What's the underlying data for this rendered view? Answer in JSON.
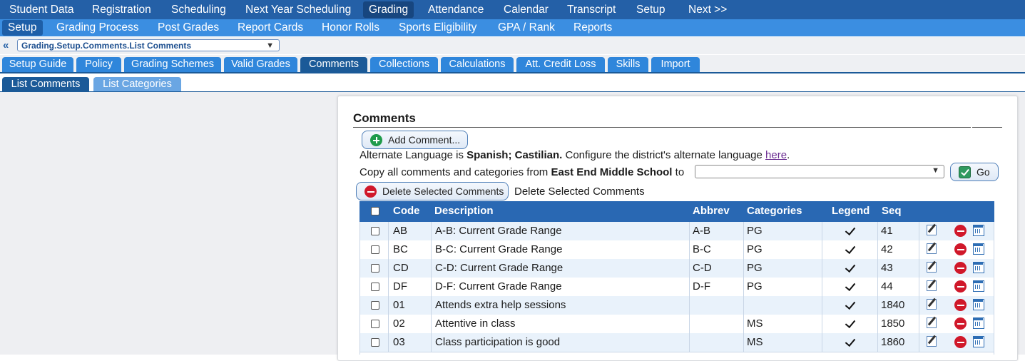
{
  "nav_primary": [
    "Student Data",
    "Registration",
    "Scheduling",
    "Next Year Scheduling",
    "Grading",
    "Attendance",
    "Calendar",
    "Transcript",
    "Setup",
    "Next >>"
  ],
  "nav_secondary": [
    "Setup",
    "Grading Process",
    "Post Grades",
    "Report Cards",
    "Honor Rolls",
    "Sports Eligibility",
    "GPA / Rank",
    "Reports"
  ],
  "breadcrumb": {
    "back_icon": "double-chevron-left-icon",
    "path": "Grading.Setup.Comments.List Comments"
  },
  "tabs": [
    "Setup Guide",
    "Policy",
    "Grading Schemes",
    "Valid Grades",
    "Comments",
    "Collections",
    "Calculations",
    "Att. Credit Loss",
    "Skills",
    "Import"
  ],
  "subtabs": [
    "List Comments",
    "List Categories"
  ],
  "panel": {
    "title": "Comments",
    "add_button": "Add Comment...",
    "alt_lang_prefix": "Alternate Language is ",
    "alt_lang_value": "Spanish; Castilian.",
    "alt_lang_suffix": " Configure the district's alternate language ",
    "alt_lang_link": "here",
    "alt_lang_end": ".",
    "copy_prefix": "Copy all comments and categories from ",
    "copy_school": "East End Middle School",
    "copy_to": " to",
    "go_button": "Go",
    "delete_button": "Delete Selected Comments",
    "delete_label": "Delete Selected Comments"
  },
  "table": {
    "headers": {
      "code": "Code",
      "description": "Description",
      "abbrev": "Abbrev",
      "categories": "Categories",
      "legend": "Legend",
      "seq": "Seq"
    },
    "rows": [
      {
        "code": "AB",
        "description": "A-B: Current Grade Range",
        "abbrev": "A-B",
        "categories": "PG",
        "legend": true,
        "seq": "41"
      },
      {
        "code": "BC",
        "description": "B-C: Current Grade Range",
        "abbrev": "B-C",
        "categories": "PG",
        "legend": true,
        "seq": "42"
      },
      {
        "code": "CD",
        "description": "C-D: Current Grade Range",
        "abbrev": "C-D",
        "categories": "PG",
        "legend": true,
        "seq": "43"
      },
      {
        "code": "DF",
        "description": "D-F: Current Grade Range",
        "abbrev": "D-F",
        "categories": "PG",
        "legend": true,
        "seq": "44"
      },
      {
        "code": "01",
        "description": "Attends extra help sessions",
        "abbrev": "",
        "categories": "",
        "legend": true,
        "seq": "1840"
      },
      {
        "code": "02",
        "description": "Attentive in class",
        "abbrev": "",
        "categories": "MS",
        "legend": true,
        "seq": "1850"
      },
      {
        "code": "03",
        "description": "Class participation is good",
        "abbrev": "",
        "categories": "MS",
        "legend": true,
        "seq": "1860"
      }
    ]
  }
}
